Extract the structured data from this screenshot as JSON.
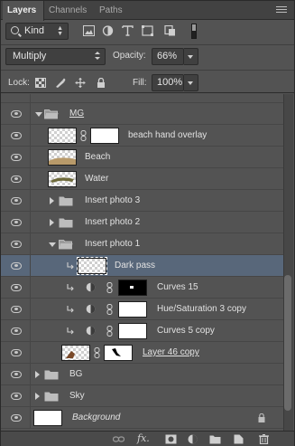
{
  "tabs": [
    {
      "label": "Layers",
      "active": true
    },
    {
      "label": "Channels",
      "active": false
    },
    {
      "label": "Paths",
      "active": false
    }
  ],
  "filter": {
    "kind_label": "Kind",
    "icons": [
      "pixel-filter-icon",
      "adjustment-filter-icon",
      "type-filter-icon",
      "shape-filter-icon",
      "smart-object-filter-icon"
    ]
  },
  "blend": {
    "mode": "Multiply",
    "opacity_label": "Opacity:",
    "opacity_value": "66%"
  },
  "lock": {
    "label": "Lock:",
    "fill_label": "Fill:",
    "fill_value": "100%"
  },
  "layers": [
    {
      "name": "MG",
      "type": "group",
      "expanded": true
    },
    {
      "name": "beach hand overlay",
      "type": "layer-mask"
    },
    {
      "name": "Beach",
      "type": "layer"
    },
    {
      "name": "Water",
      "type": "layer"
    },
    {
      "name": "Insert photo 3",
      "type": "group",
      "expanded": false
    },
    {
      "name": "Insert photo 2",
      "type": "group",
      "expanded": false
    },
    {
      "name": "Insert photo 1",
      "type": "group",
      "expanded": true
    },
    {
      "name": "Dark pass",
      "type": "layer",
      "selected": true
    },
    {
      "name": "Curves 15",
      "type": "adjustment"
    },
    {
      "name": "Hue/Saturation 3 copy",
      "type": "adjustment"
    },
    {
      "name": "Curves 5 copy",
      "type": "adjustment"
    },
    {
      "name": "Layer 46 copy",
      "type": "layer-mask"
    },
    {
      "name": "BG",
      "type": "group",
      "expanded": false
    },
    {
      "name": "Sky",
      "type": "group",
      "expanded": false
    },
    {
      "name": "Background",
      "type": "background",
      "locked": true
    }
  ],
  "footer": {
    "fx_label": "fx.",
    "icons": [
      "link-layers-icon",
      "fx-icon",
      "add-mask-icon",
      "new-adjustment-icon",
      "new-group-icon",
      "new-layer-icon",
      "delete-icon"
    ]
  },
  "colors": {
    "panel_bg": "#535353",
    "selected_row": "#58677a"
  }
}
